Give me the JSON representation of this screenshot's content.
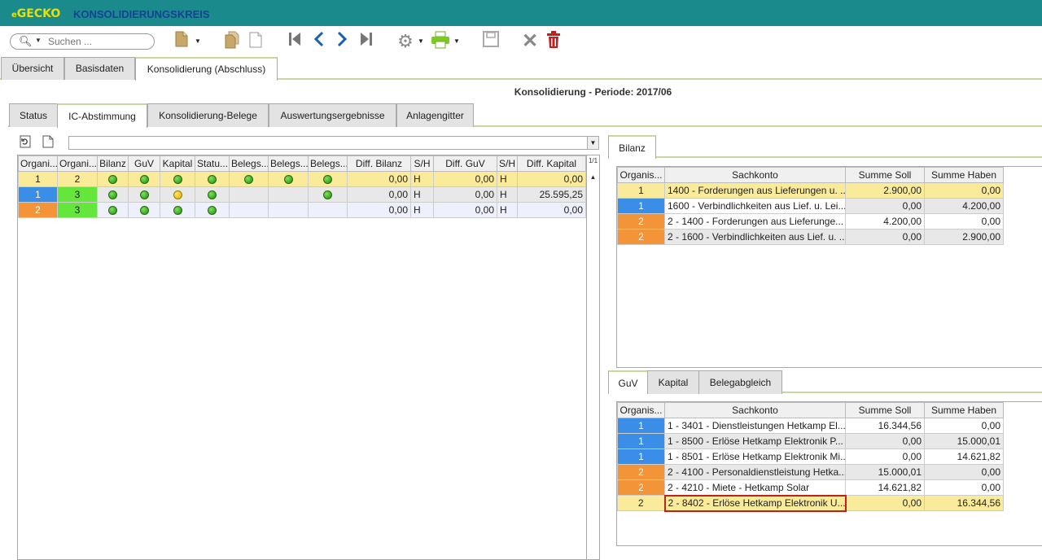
{
  "app": {
    "logo": "GECKO",
    "logo_prefix": "e",
    "title": "KONSOLIDIERUNGSKREIS"
  },
  "toolbar": {
    "search_placeholder": "Suchen ..."
  },
  "main_tabs": [
    {
      "label": "Übersicht"
    },
    {
      "label": "Basisdaten"
    },
    {
      "label": "Konsolidierung (Abschluss)"
    }
  ],
  "periode": "Konsolidierung - Periode: 2017/06",
  "sub_tabs": [
    {
      "label": "Status"
    },
    {
      "label": "IC-Abstimmung"
    },
    {
      "label": "Konsolidierung-Belege"
    },
    {
      "label": "Auswertungsergebnisse"
    },
    {
      "label": "Anlagengitter"
    }
  ],
  "left_grid": {
    "page_info": "1/1",
    "headers": [
      "Organi...",
      "Organi...",
      "Bilanz",
      "GuV",
      "Kapital",
      "Statu...",
      "Belegs...",
      "Belegs...",
      "Belegs...",
      "Diff. Bilanz",
      "S/H",
      "Diff. GuV",
      "S/H",
      "Diff. Kapital"
    ],
    "rows": [
      {
        "org1": "1",
        "org2": "2",
        "bilanz": "green",
        "guv": "green",
        "kapital": "green",
        "status": "green",
        "b1": "green",
        "b2": "green",
        "b3": "green",
        "diff_bilanz": "0,00",
        "sh1": "H",
        "diff_guv": "0,00",
        "sh2": "H",
        "diff_kapital": "0,00"
      },
      {
        "org1": "1",
        "org2": "3",
        "bilanz": "green",
        "guv": "green",
        "kapital": "yellow",
        "status": "green",
        "b1": "",
        "b2": "",
        "b3": "green",
        "diff_bilanz": "0,00",
        "sh1": "H",
        "diff_guv": "0,00",
        "sh2": "H",
        "diff_kapital": "25.595,25"
      },
      {
        "org1": "2",
        "org2": "3",
        "bilanz": "green",
        "guv": "green",
        "kapital": "green",
        "status": "green",
        "b1": "",
        "b2": "",
        "b3": "",
        "diff_bilanz": "0,00",
        "sh1": "H",
        "diff_guv": "0,00",
        "sh2": "H",
        "diff_kapital": "0,00"
      }
    ]
  },
  "bilanz_tab": {
    "label": "Bilanz"
  },
  "bilanz_grid": {
    "headers": [
      "Organis...",
      "Sachkonto",
      "Summe Soll",
      "Summe Haben"
    ],
    "rows": [
      {
        "org": "1",
        "konto": "1400 - Forderungen aus Lieferungen u. ...",
        "soll": "2.900,00",
        "haben": "0,00"
      },
      {
        "org": "1",
        "konto": "1600 - Verbindlichkeiten aus Lief. u. Lei...",
        "soll": "0,00",
        "haben": "4.200,00"
      },
      {
        "org": "2",
        "konto": "2 - 1400 - Forderungen aus Lieferunge...",
        "soll": "4.200,00",
        "haben": "0,00"
      },
      {
        "org": "2",
        "konto": "2 - 1600 - Verbindlichkeiten aus Lief. u. ...",
        "soll": "0,00",
        "haben": "2.900,00"
      }
    ]
  },
  "bottom_tabs": [
    {
      "label": "GuV"
    },
    {
      "label": "Kapital"
    },
    {
      "label": "Belegabgleich"
    }
  ],
  "guv_grid": {
    "headers": [
      "Organis...",
      "Sachkonto",
      "Summe Soll",
      "Summe Haben"
    ],
    "rows": [
      {
        "org": "1",
        "konto": "1 - 3401 - Dienstleistungen Hetkamp El...",
        "soll": "16.344,56",
        "haben": "0,00"
      },
      {
        "org": "1",
        "konto": "1 - 8500 - Erlöse Hetkamp Elektronik P...",
        "soll": "0,00",
        "haben": "15.000,01"
      },
      {
        "org": "1",
        "konto": "1 - 8501 - Erlöse Hetkamp Elektronik Mi...",
        "soll": "0,00",
        "haben": "14.621,82"
      },
      {
        "org": "2",
        "konto": "2 - 4100 - Personaldienstleistung Hetka...",
        "soll": "15.000,01",
        "haben": "0,00"
      },
      {
        "org": "2",
        "konto": "2 - 4210 - Miete - Hetkamp Solar",
        "soll": "14.621,82",
        "haben": "0,00"
      },
      {
        "org": "2",
        "konto": "2 - 8402 - Erlöse Hetkamp Elektronik U...",
        "soll": "0,00",
        "haben": "16.344,56"
      }
    ]
  },
  "colors": {
    "titlebar": "#1a8a8c",
    "logo": "#e8e000",
    "title": "#1b3f9a",
    "org1": "#3b8ee8",
    "org2": "#f39439",
    "org3": "#64e63c",
    "selected_row": "#faeb9a"
  }
}
